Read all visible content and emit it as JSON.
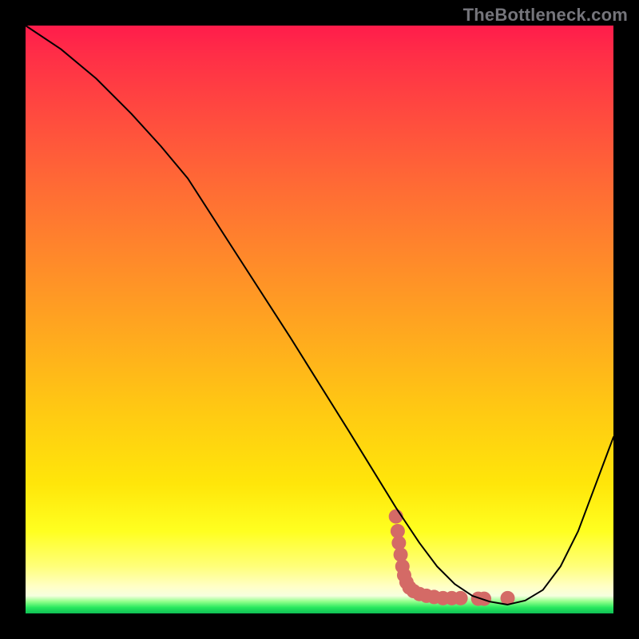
{
  "watermark": "TheBottleneck.com",
  "chart_data": {
    "type": "line",
    "title": "",
    "xlabel": "",
    "ylabel": "",
    "xlim": [
      0,
      100
    ],
    "ylim": [
      0,
      100
    ],
    "grid": false,
    "legend": false,
    "background_gradient": {
      "direction": "vertical",
      "stops": [
        {
          "pos": 0.0,
          "color": "#ff1c4b"
        },
        {
          "pos": 0.15,
          "color": "#ff4a3f"
        },
        {
          "pos": 0.4,
          "color": "#ff8a2a"
        },
        {
          "pos": 0.65,
          "color": "#ffc813"
        },
        {
          "pos": 0.86,
          "color": "#ffff20"
        },
        {
          "pos": 0.95,
          "color": "#ffffc8"
        },
        {
          "pos": 0.98,
          "color": "#8fff8a"
        },
        {
          "pos": 1.0,
          "color": "#0fbf55"
        }
      ]
    },
    "series": [
      {
        "name": "curve",
        "color": "#000000",
        "stroke_width": 2,
        "x": [
          0.0,
          6.0,
          12.0,
          18.0,
          23.0,
          27.6,
          35.0,
          45.0,
          55.0,
          63.0,
          67.0,
          70.0,
          73.0,
          76.0,
          79.0,
          82.0,
          85.0,
          88.0,
          91.0,
          94.0,
          97.0,
          100.0
        ],
        "y": [
          100.0,
          96.0,
          91.0,
          85.0,
          79.5,
          74.0,
          62.5,
          47.0,
          31.0,
          18.0,
          12.0,
          8.0,
          5.0,
          3.0,
          2.0,
          1.5,
          2.2,
          4.0,
          8.0,
          14.0,
          22.0,
          30.0
        ]
      }
    ],
    "highlight": {
      "name": "highlight-dots",
      "color": "#d46a66",
      "points": [
        {
          "x": 63.0,
          "y": 16.5
        },
        {
          "x": 63.3,
          "y": 14.0
        },
        {
          "x": 63.5,
          "y": 12.0
        },
        {
          "x": 63.8,
          "y": 10.0
        },
        {
          "x": 64.1,
          "y": 8.0
        },
        {
          "x": 64.4,
          "y": 6.5
        },
        {
          "x": 64.8,
          "y": 5.3
        },
        {
          "x": 65.3,
          "y": 4.4
        },
        {
          "x": 66.0,
          "y": 3.8
        },
        {
          "x": 67.0,
          "y": 3.3
        },
        {
          "x": 68.2,
          "y": 3.0
        },
        {
          "x": 69.5,
          "y": 2.8
        },
        {
          "x": 71.0,
          "y": 2.6
        },
        {
          "x": 72.5,
          "y": 2.6
        },
        {
          "x": 74.0,
          "y": 2.6
        },
        {
          "x": 77.0,
          "y": 2.5
        },
        {
          "x": 78.0,
          "y": 2.5
        },
        {
          "x": 82.0,
          "y": 2.6
        }
      ],
      "radius": 9
    }
  }
}
